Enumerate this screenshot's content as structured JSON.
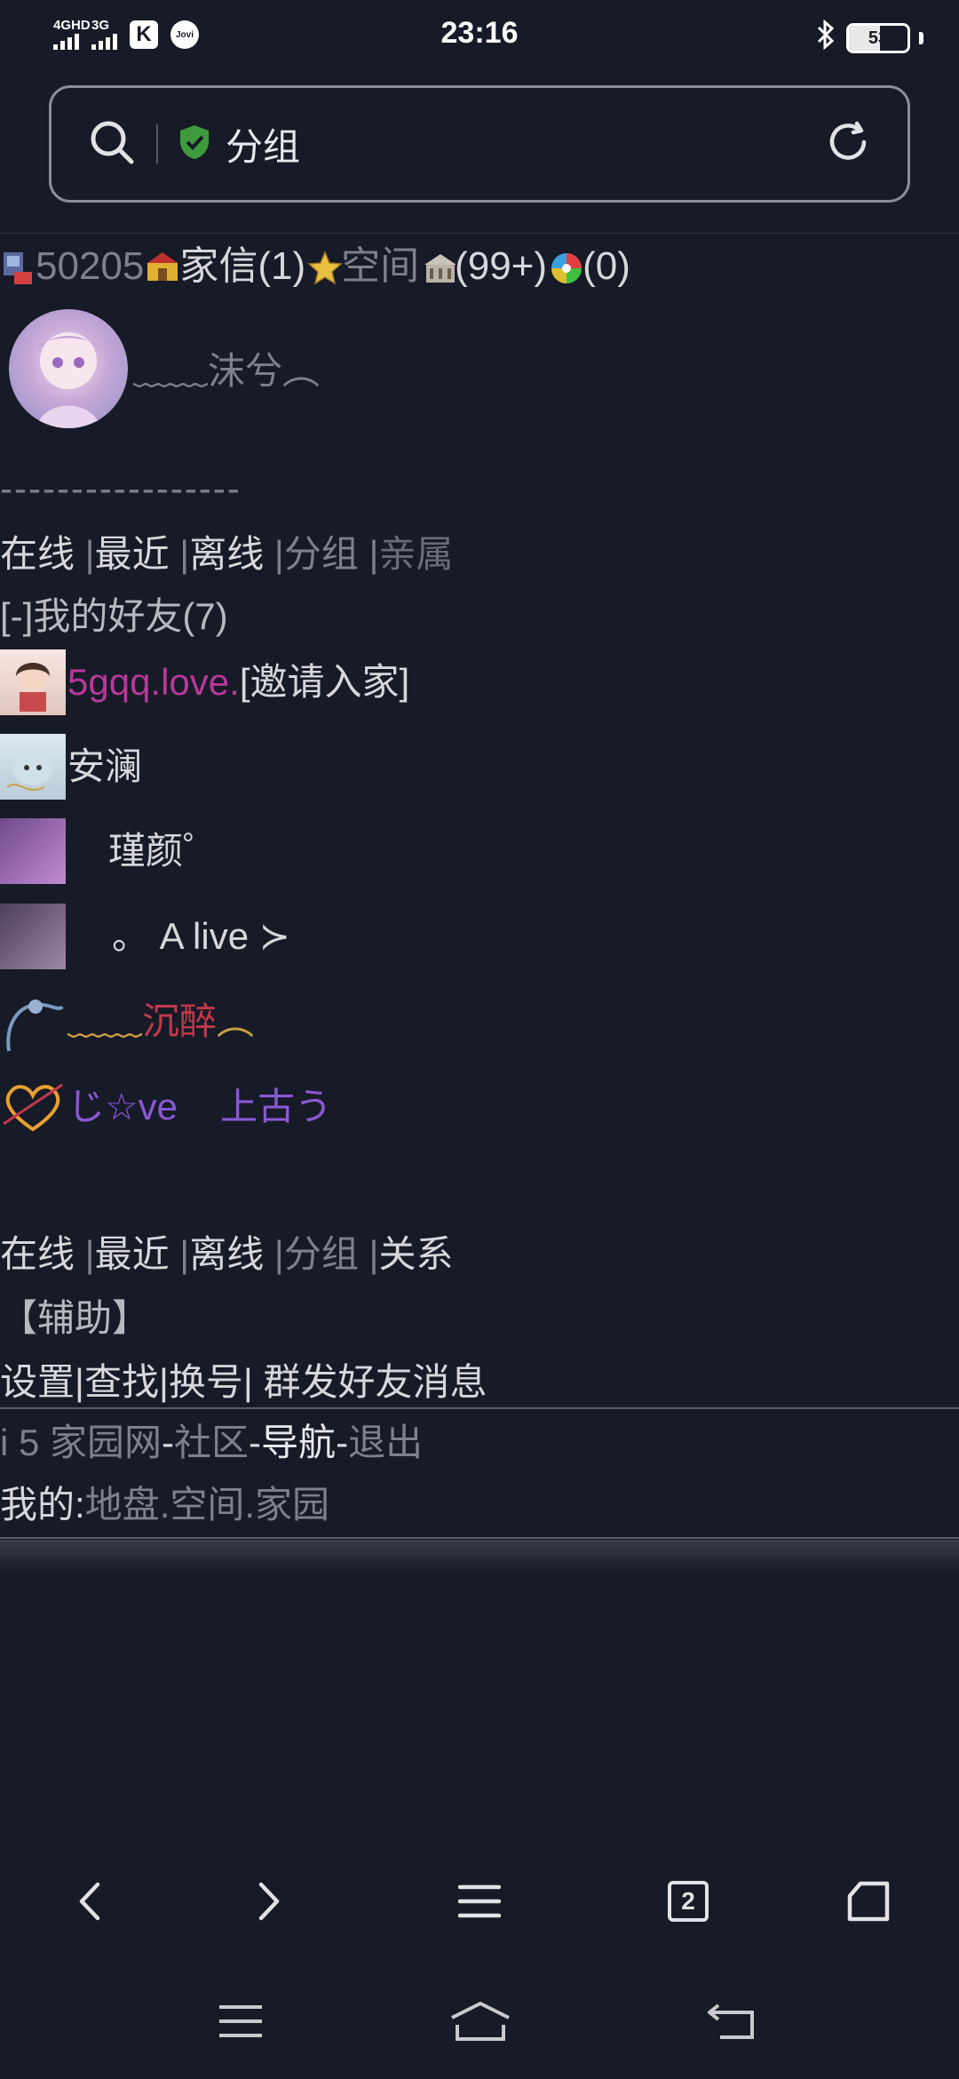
{
  "status_bar": {
    "signal1_label": "4GHD",
    "signal2_label": "3G",
    "k_app": "K",
    "jovi_label": "Jovi",
    "time": "23:16",
    "battery_level": "53",
    "battery_fraction": 0.53
  },
  "address_bar": {
    "title": "分组",
    "icons": [
      "search-icon",
      "shield-check-icon",
      "refresh-icon"
    ]
  },
  "top_line": {
    "id": "50205",
    "mail_label": "家信(1)",
    "space_label": "空间",
    "house_count": "(99+)",
    "color_count": "(0)"
  },
  "profile": {
    "nickname": "﹏﹏沫兮︵"
  },
  "separator": "-----------------",
  "tabs_top": {
    "online": "在线",
    "recent": "最近",
    "offline": "离线",
    "group": "分组",
    "family": "亲属"
  },
  "group_header": "[-]我的好友(7)",
  "friends": [
    {
      "name": "5gqq.love.",
      "action": "[邀请入家]"
    },
    {
      "name": "安澜"
    },
    {
      "name": "瑾颜゜"
    },
    {
      "name": "。 A live ≻"
    },
    {
      "name_a": "﹏﹏",
      "name_b": "沉醉",
      "name_c": "︵"
    },
    {
      "name_a": "じ☆ve",
      "name_b": "上古う"
    }
  ],
  "tabs_bottom": {
    "online": "在线",
    "recent": "最近",
    "offline": "离线",
    "group": "分组",
    "relation": "关系"
  },
  "assist": {
    "title": "【辅助】",
    "settings": "设置",
    "find": "查找",
    "switch": "换号",
    "mass_msg": "群发好友消息"
  },
  "footer": {
    "site": "i 5 家园网",
    "community": "社区",
    "nav": "导航",
    "logout": "退出",
    "mine_prefix": "我的:",
    "land": "地盘",
    "space": "空间",
    "home": "家园"
  },
  "browser_nav": {
    "tab_count": "2"
  },
  "colors": {
    "background": "#171a27",
    "shield_green": "#3f9a3c",
    "pink": "#b8389a",
    "purple": "#8a59d4",
    "drunk_red": "#c0394a"
  }
}
